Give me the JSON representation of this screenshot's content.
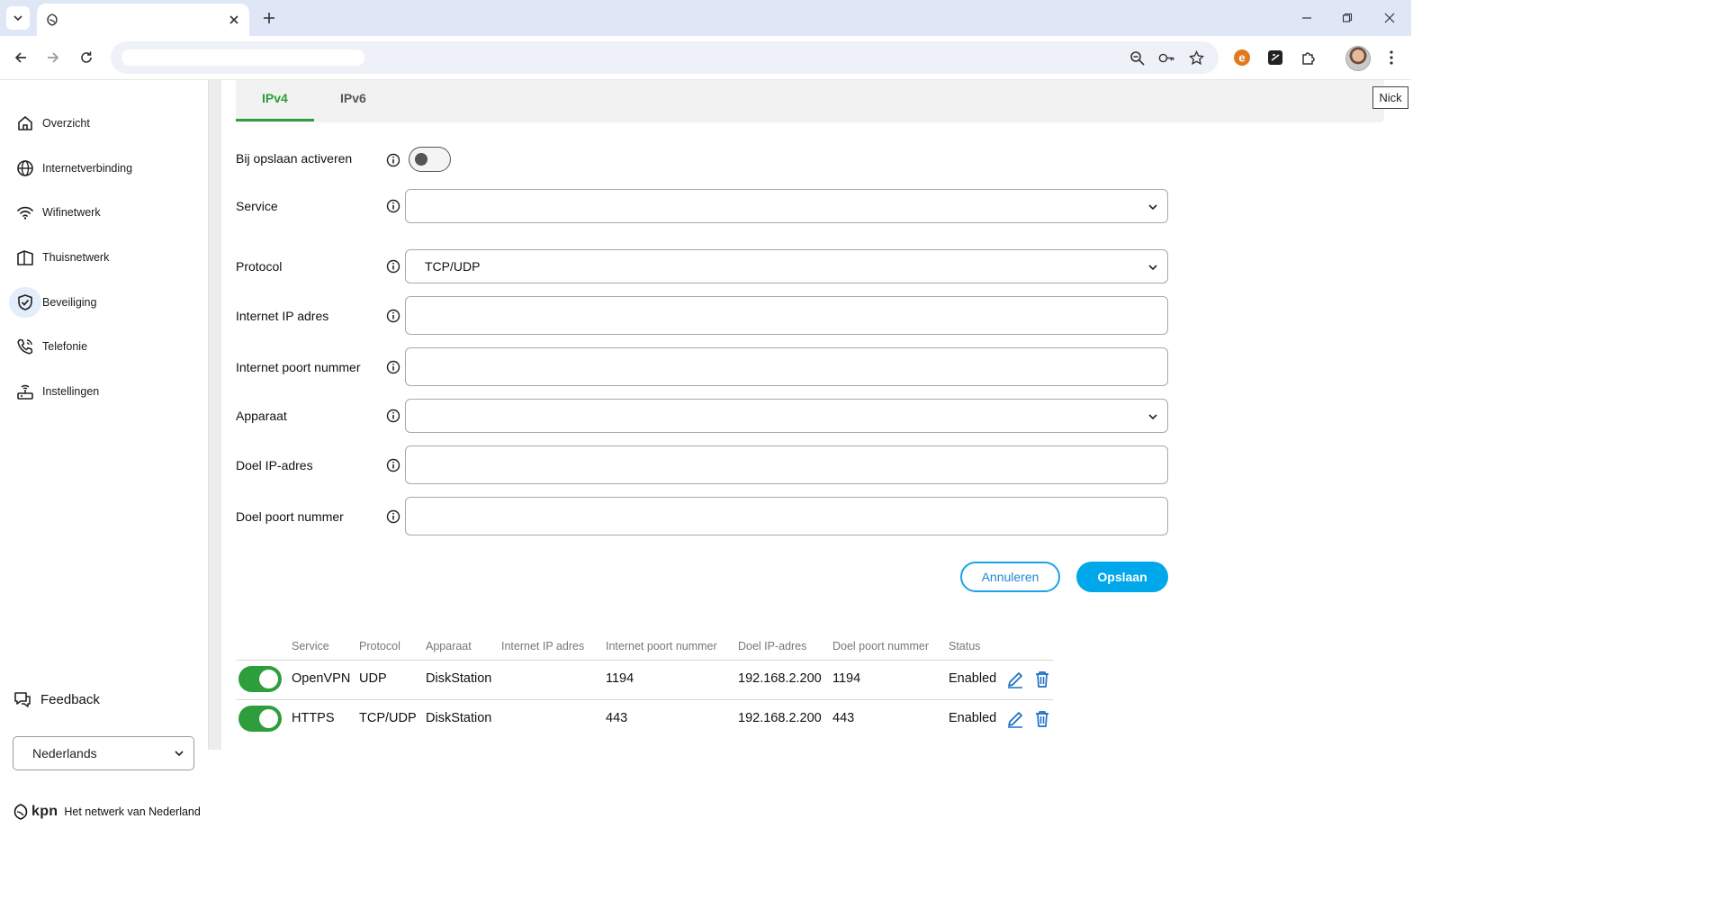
{
  "browser": {
    "tab_title": "",
    "url": "",
    "tooltip": "Nick"
  },
  "sidebar": {
    "items": [
      {
        "label": "Overzicht",
        "icon": "home-icon"
      },
      {
        "label": "Internetverbinding",
        "icon": "globe-icon"
      },
      {
        "label": "Wifinetwerk",
        "icon": "wifi-icon"
      },
      {
        "label": "Thuisnetwerk",
        "icon": "house-network-icon"
      },
      {
        "label": "Beveiliging",
        "icon": "shield-check-icon",
        "active": true
      },
      {
        "label": "Telefonie",
        "icon": "phone-icon"
      },
      {
        "label": "Instellingen",
        "icon": "router-icon"
      }
    ],
    "feedback_label": "Feedback",
    "language": "Nederlands",
    "brand": {
      "logo_text": "kpn",
      "slogan": "Het netwerk van Nederland"
    }
  },
  "tabs": [
    {
      "label": "IPv4",
      "active": true
    },
    {
      "label": "IPv6",
      "active": false
    }
  ],
  "form": {
    "activate_on_save_label": "Bij opslaan activeren",
    "activate_on_save": false,
    "service_label": "Service",
    "service_value": "",
    "protocol_label": "Protocol",
    "protocol_value": "TCP/UDP",
    "internet_ip_label": "Internet IP adres",
    "internet_ip_value": "",
    "internet_port_label": "Internet poort nummer",
    "internet_port_value": "",
    "device_label": "Apparaat",
    "device_value": "",
    "target_ip_label": "Doel IP-adres",
    "target_ip_value": "",
    "target_port_label": "Doel poort nummer",
    "target_port_value": "",
    "cancel_label": "Annuleren",
    "save_label": "Opslaan"
  },
  "table": {
    "headers": [
      "Service",
      "Protocol",
      "Apparaat",
      "Internet IP adres",
      "Internet poort nummer",
      "Doel IP-adres",
      "Doel poort nummer",
      "Status"
    ],
    "rows": [
      {
        "enabled": true,
        "service": "OpenVPN",
        "protocol": "UDP",
        "device": "DiskStation",
        "internet_ip": "",
        "internet_port": "1194",
        "target_ip": "192.168.2.200",
        "target_port": "1194",
        "status": "Enabled"
      },
      {
        "enabled": true,
        "service": "HTTPS",
        "protocol": "TCP/UDP",
        "device": "DiskStation",
        "internet_ip": "",
        "internet_port": "443",
        "target_ip": "192.168.2.200",
        "target_port": "443",
        "status": "Enabled"
      }
    ]
  },
  "colors": {
    "accent_green": "#2e9d3c",
    "primary_blue": "#00a7ea",
    "icon_blue": "#1a6fc4"
  }
}
